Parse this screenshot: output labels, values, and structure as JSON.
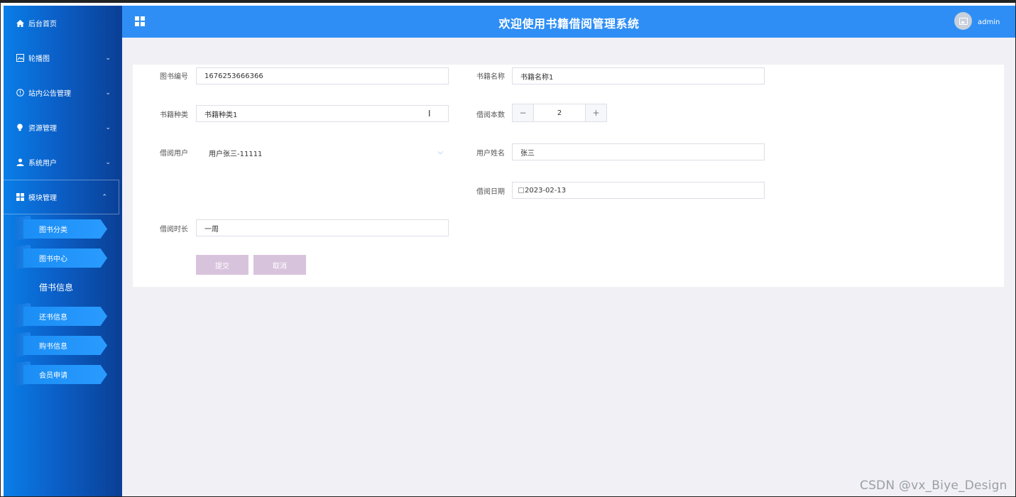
{
  "header": {
    "title": "欢迎使用书籍借阅管理系统",
    "username": "admin",
    "accent_color": "#2e8ef5"
  },
  "sidebar": {
    "items": [
      {
        "label": "后台首页",
        "icon": "home-icon"
      },
      {
        "label": "轮播图",
        "icon": "image-icon"
      },
      {
        "label": "站内公告管理",
        "icon": "info-circle-icon"
      },
      {
        "label": "资源管理",
        "icon": "bulb-icon"
      },
      {
        "label": "系统用户",
        "icon": "user-icon"
      },
      {
        "label": "模块管理",
        "icon": "grid-icon"
      }
    ],
    "sub_items": [
      {
        "label": "图书分类"
      },
      {
        "label": "图书中心"
      },
      {
        "label": "借书信息"
      },
      {
        "label": "还书信息"
      },
      {
        "label": "购书信息"
      },
      {
        "label": "会员申请"
      }
    ]
  },
  "form": {
    "book_no": {
      "label": "图书编号",
      "value": "1676253666366"
    },
    "book_name": {
      "label": "书籍名称",
      "value": "书籍名称1"
    },
    "book_type": {
      "label": "书籍种类",
      "value": "书籍种类1"
    },
    "borrow_count": {
      "label": "借阅本数",
      "value": "2",
      "minus": "−",
      "plus": "+"
    },
    "borrow_user": {
      "label": "借阅用户",
      "value": "用户张三-11111"
    },
    "user_name": {
      "label": "用户姓名",
      "value": "张三"
    },
    "borrow_date": {
      "label": "借阅日期",
      "value": "2023-02-13"
    },
    "borrow_duration": {
      "label": "借阅时长",
      "value": "一周"
    },
    "submit_label": "提交",
    "cancel_label": "取消"
  },
  "watermark": "CSDN @vx_Biye_Design"
}
